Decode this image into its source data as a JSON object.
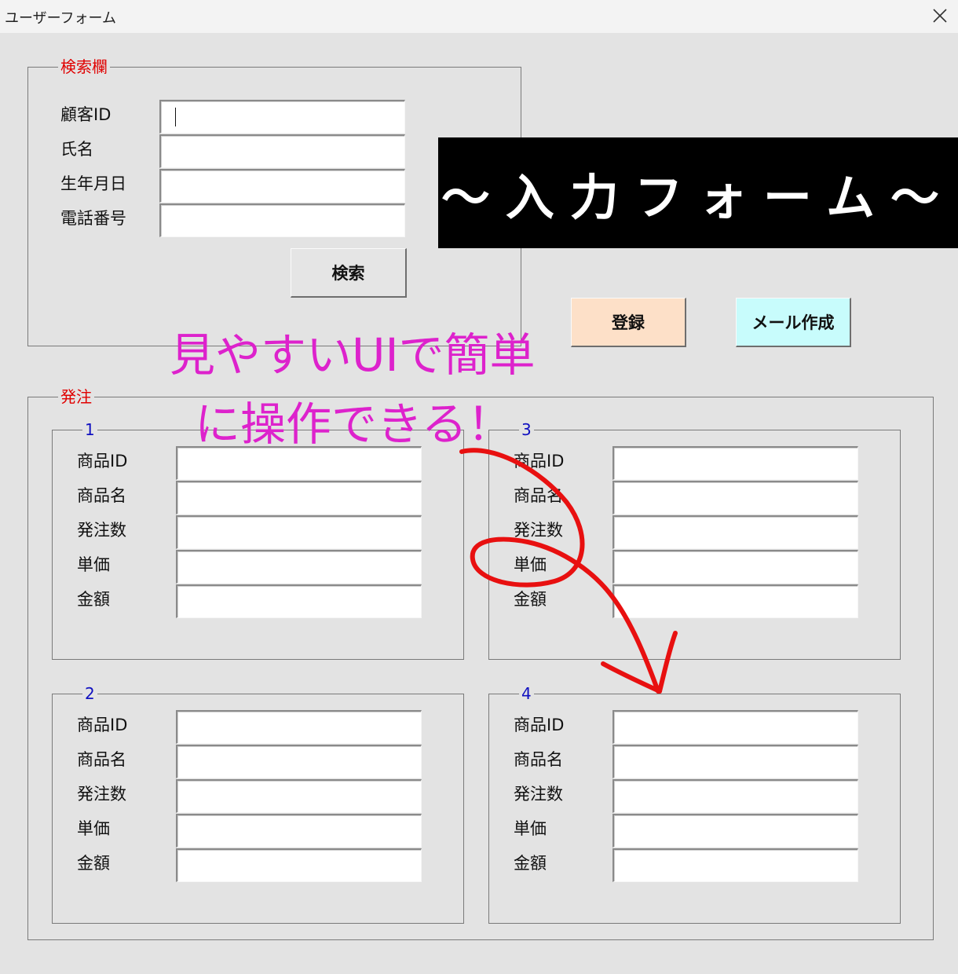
{
  "window": {
    "title": "ユーザーフォーム",
    "close_glyph": "✕"
  },
  "search": {
    "legend": "検索欄",
    "fields": [
      {
        "label": "顧客ID",
        "value": ""
      },
      {
        "label": "氏名",
        "value": ""
      },
      {
        "label": "生年月日",
        "value": ""
      },
      {
        "label": "電話番号",
        "value": ""
      }
    ],
    "button": "検索"
  },
  "banner": {
    "text": "～入力フォーム～"
  },
  "actions": {
    "register": "登録",
    "mail": "メール作成",
    "register_color": "#fde0c8",
    "mail_color": "#c8fcfc"
  },
  "annotation": {
    "line1": "見やすいUIで簡単",
    "line2": "に操作できる！",
    "color": "#dd22cc",
    "scribble_color": "#e81010"
  },
  "order": {
    "legend": "発注",
    "groups": [
      {
        "caption": "1",
        "labels": [
          "商品ID",
          "商品名",
          "発注数",
          "単価",
          "金額"
        ]
      },
      {
        "caption": "3",
        "labels": [
          "商品ID",
          "商品名",
          "発注数",
          "単価",
          "金額"
        ]
      },
      {
        "caption": "2",
        "labels": [
          "商品ID",
          "商品名",
          "発注数",
          "単価",
          "金額"
        ]
      },
      {
        "caption": "4",
        "labels": [
          "商品ID",
          "商品名",
          "発注数",
          "単価",
          "金額"
        ]
      }
    ]
  }
}
